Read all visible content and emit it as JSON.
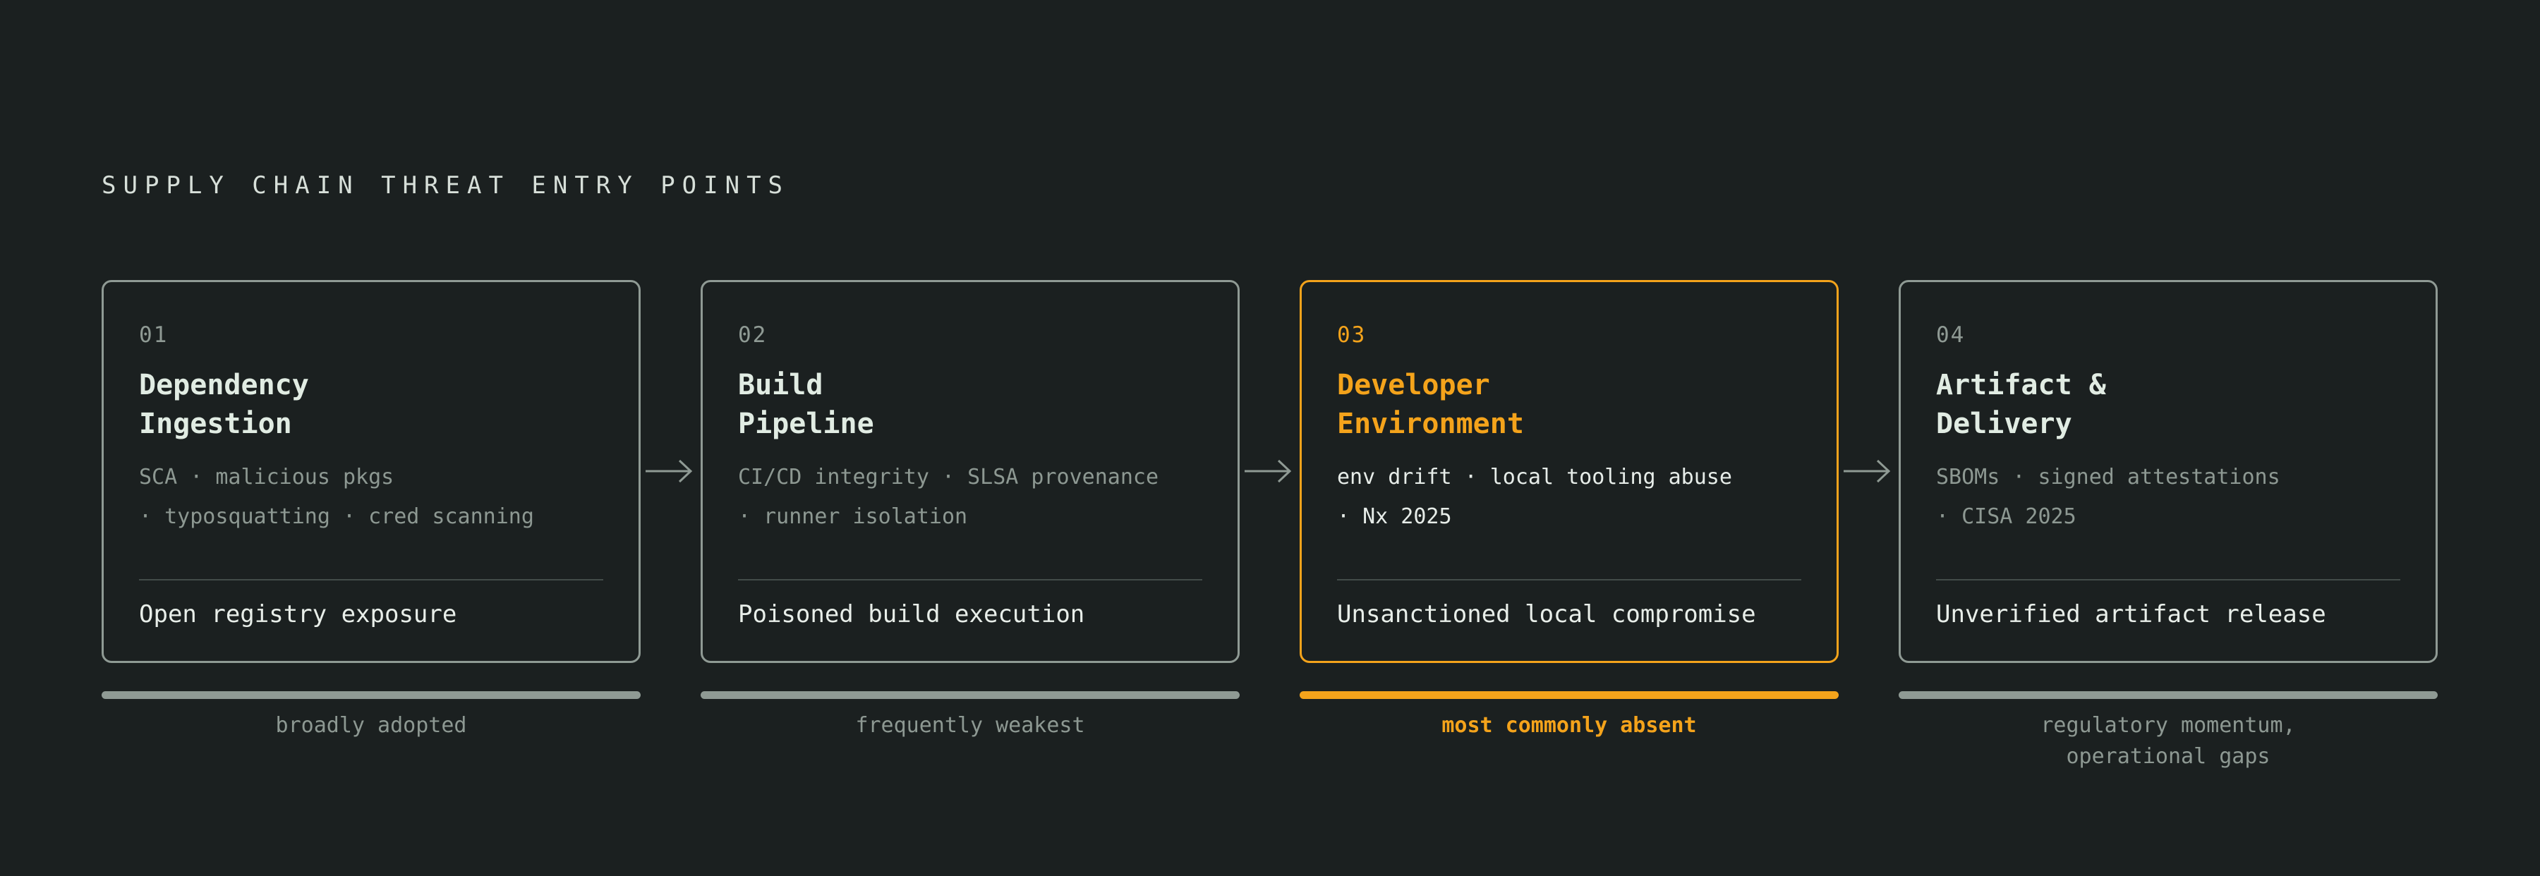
{
  "title": "SUPPLY CHAIN THREAT ENTRY POINTS",
  "colors": {
    "background": "#1b2020",
    "neutral": "#8f9a94",
    "accent": "#f4a31b",
    "text": "#e1ece3"
  },
  "stages": [
    {
      "number": "01",
      "name": [
        "Dependency",
        "Ingestion"
      ],
      "tags": [
        "SCA · malicious pkgs",
        "· typosquatting · cred scanning"
      ],
      "outcome": "Open registry exposure",
      "caption": [
        "broadly adopted"
      ],
      "highlighted": false
    },
    {
      "number": "02",
      "name": [
        "Build",
        "Pipeline"
      ],
      "tags": [
        "CI/CD integrity · SLSA provenance",
        "· runner isolation"
      ],
      "outcome": "Poisoned build execution",
      "caption": [
        "frequently weakest"
      ],
      "highlighted": false
    },
    {
      "number": "03",
      "name": [
        "Developer",
        "Environment"
      ],
      "tags": [
        "env drift · local tooling abuse",
        "· Nx 2025"
      ],
      "outcome": "Unsanctioned local compromise",
      "caption": [
        "most commonly absent"
      ],
      "highlighted": true
    },
    {
      "number": "04",
      "name": [
        "Artifact &",
        "Delivery"
      ],
      "tags": [
        "SBOMs · signed attestations",
        "· CISA 2025"
      ],
      "outcome": "Unverified artifact release",
      "caption": [
        "regulatory momentum,",
        "operational gaps"
      ],
      "highlighted": false
    }
  ]
}
